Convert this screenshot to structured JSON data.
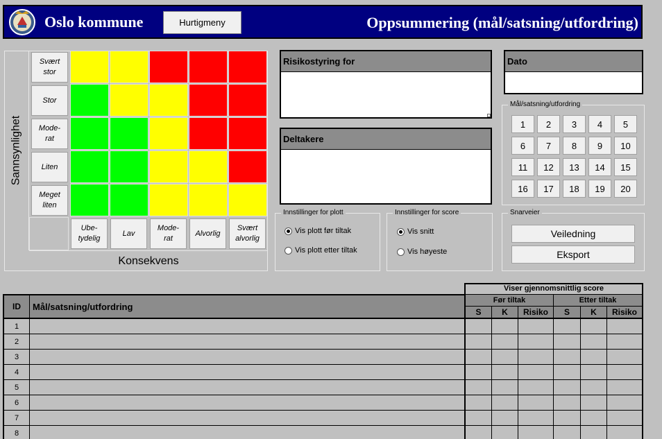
{
  "header": {
    "brand": "Oslo kommune",
    "menu_button": "Hurtigmeny",
    "title": "Oppsummering (mål/satsning/utfordring)"
  },
  "matrix": {
    "y_axis_label": "Sannsynlighet",
    "x_axis_label": "Konsekvens",
    "rows": [
      "Svært\nstor",
      "Stor",
      "Mode-\nrat",
      "Liten",
      "Meget\nliten"
    ],
    "cols": [
      "Ube-\ntydelig",
      "Lav",
      "Mode-\nrat",
      "Alvorlig",
      "Svært\nalvorlig"
    ],
    "colors": {
      "green": "#00ff00",
      "yellow": "#ffff00",
      "red": "#ff0000"
    },
    "grid": [
      [
        "yellow",
        "yellow",
        "red",
        "red",
        "red"
      ],
      [
        "green",
        "yellow",
        "yellow",
        "red",
        "red"
      ],
      [
        "green",
        "green",
        "yellow",
        "red",
        "red"
      ],
      [
        "green",
        "green",
        "yellow",
        "yellow",
        "red"
      ],
      [
        "green",
        "green",
        "yellow",
        "yellow",
        "yellow"
      ]
    ]
  },
  "fields": {
    "risikostyring_label": "Risikostyring for",
    "risikostyring_value": "",
    "deltakere_label": "Deltakere",
    "deltakere_value": "",
    "dato_label": "Dato",
    "dato_value": ""
  },
  "goals_group": {
    "label": "Mål/satsning/utfordring",
    "buttons": [
      "1",
      "2",
      "3",
      "4",
      "5",
      "6",
      "7",
      "8",
      "9",
      "10",
      "11",
      "12",
      "13",
      "14",
      "15",
      "16",
      "17",
      "18",
      "19",
      "20"
    ]
  },
  "plot_settings": {
    "label": "Innstillinger for plott",
    "options": [
      "Vis plott før tiltak",
      "Vis plott etter tiltak"
    ],
    "selected_index": 0
  },
  "score_settings": {
    "label": "Innstillinger for score",
    "options": [
      "Vis snitt",
      "Vis høyeste"
    ],
    "selected_index": 0
  },
  "shortcuts": {
    "label": "Snarveier",
    "guide_button": "Veiledning",
    "export_button": "Eksport"
  },
  "table": {
    "super_header": "Viser gjennomsnittlig score",
    "id_header": "ID",
    "goal_header": "Mål/satsning/utfordring",
    "before_header": "Før tiltak",
    "after_header": "Etter tiltak",
    "sub_headers": [
      "S",
      "K",
      "Risiko",
      "S",
      "K",
      "Risiko"
    ],
    "row_ids": [
      "1",
      "2",
      "3",
      "4",
      "5",
      "6",
      "7",
      "8"
    ]
  }
}
